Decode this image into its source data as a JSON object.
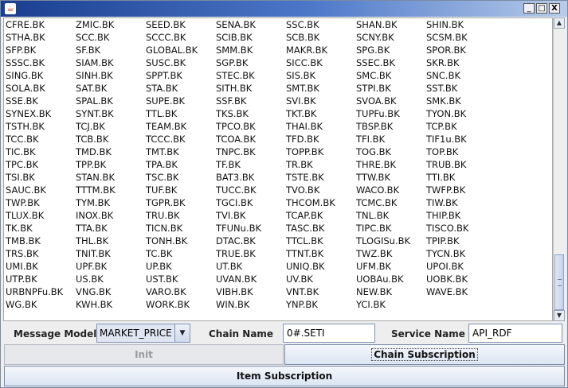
{
  "window": {
    "title": "",
    "controls": {
      "minimize": "_",
      "maximize": "□",
      "close": "X"
    }
  },
  "symbols": [
    "CFRE.BK",
    "ZMIC.BK",
    "SEED.BK",
    "SENA.BK",
    "SSC.BK",
    "SHAN.BK",
    "SHIN.BK",
    "STHA.BK",
    "SCC.BK",
    "SCCC.BK",
    "SCIB.BK",
    "SCB.BK",
    "SCNY.BK",
    "SCSM.BK",
    "SFP.BK",
    "SF.BK",
    "GLOBAL.BK",
    "SMM.BK",
    "MAKR.BK",
    "SPG.BK",
    "SPOR.BK",
    "SSSC.BK",
    "SIAM.BK",
    "SUSC.BK",
    "SGP.BK",
    "SICC.BK",
    "SSEC.BK",
    "SKR.BK",
    "SING.BK",
    "SINH.BK",
    "SPPT.BK",
    "STEC.BK",
    "SIS.BK",
    "SMC.BK",
    "SNC.BK",
    "SOLA.BK",
    "SAT.BK",
    "STA.BK",
    "SITH.BK",
    "SMT.BK",
    "STPI.BK",
    "SST.BK",
    "SSE.BK",
    "SPAL.BK",
    "SUPE.BK",
    "SSF.BK",
    "SVI.BK",
    "SVOA.BK",
    "SMK.BK",
    "SYNEX.BK",
    "SYNT.BK",
    "TTL.BK",
    "TKS.BK",
    "TKT.BK",
    "TUPFu.BK",
    "TYON.BK",
    "TSTH.BK",
    "TCJ.BK",
    "TEAM.BK",
    "TPCO.BK",
    "THAI.BK",
    "TBSP.BK",
    "TCP.BK",
    "TCC.BK",
    "TCB.BK",
    "TCCC.BK",
    "TCOA.BK",
    "TFD.BK",
    "TFI.BK",
    "TIF1u.BK",
    "TIC.BK",
    "TMD.BK",
    "TMT.BK",
    "TNPC.BK",
    "TOPP.BK",
    "TOG.BK",
    "TOP.BK",
    "TPC.BK",
    "TPP.BK",
    "TPA.BK",
    "TF.BK",
    "TR.BK",
    "THRE.BK",
    "TRUB.BK",
    "TSI.BK",
    "STAN.BK",
    "TSC.BK",
    "BAT3.BK",
    "TSTE.BK",
    "TTW.BK",
    "TTI.BK",
    "SAUC.BK",
    "TTTM.BK",
    "TUF.BK",
    "TUCC.BK",
    "TVO.BK",
    "WACO.BK",
    "TWFP.BK",
    "TWP.BK",
    "TYM.BK",
    "TGPR.BK",
    "TGCI.BK",
    "THCOM.BK",
    "TCMC.BK",
    "TIW.BK",
    "TLUX.BK",
    "INOX.BK",
    "TRU.BK",
    "TVI.BK",
    "TCAP.BK",
    "TNL.BK",
    "THIP.BK",
    "TK.BK",
    "TTA.BK",
    "TICN.BK",
    "TFUNu.BK",
    "TASC.BK",
    "TIPC.BK",
    "TISCO.BK",
    "TMB.BK",
    "THL.BK",
    "TONH.BK",
    "DTAC.BK",
    "TTCL.BK",
    "TLOGISu.BK",
    "TPIP.BK",
    "TRS.BK",
    "TNIT.BK",
    "TC.BK",
    "TRUE.BK",
    "TTNT.BK",
    "TWZ.BK",
    "TYCN.BK",
    "UMI.BK",
    "UPF.BK",
    "UP.BK",
    "UT.BK",
    "UNIQ.BK",
    "UFM.BK",
    "UPOI.BK",
    "UTP.BK",
    "US.BK",
    "UST.BK",
    "UVAN.BK",
    "UV.BK",
    "UOBAu.BK",
    "UOBK.BK",
    "URBNPFu.BK",
    "VNG.BK",
    "VARO.BK",
    "VIBH.BK",
    "VNT.BK",
    "NEW.BK",
    "WAVE.BK",
    "WG.BK",
    "KWH.BK",
    "WORK.BK",
    "WIN.BK",
    "YNP.BK",
    "YCI.BK",
    ""
  ],
  "form": {
    "message_model_label": "Message Model",
    "message_model_value": "MARKET_PRICE",
    "chain_name_label": "Chain Name",
    "chain_name_value": "0#.SETI",
    "service_name_label": "Service Name",
    "service_name_value": "API_RDF"
  },
  "buttons": {
    "init": "Init",
    "chain_subscription": "Chain Subscription",
    "item_subscription": "Item Subscription"
  },
  "scroll": {
    "position_fraction": 0.9
  },
  "colors": {
    "titlebar_start": "#1a3d8f",
    "titlebar_end": "#b7cbe9",
    "button_face": "#dbe5f3",
    "disabled_text": "#9a9a9a"
  }
}
